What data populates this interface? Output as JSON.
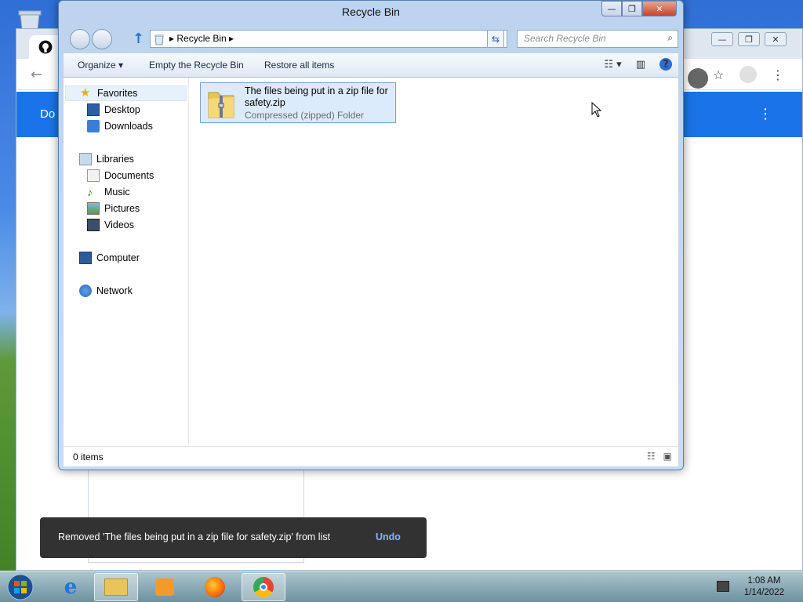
{
  "explorer": {
    "title": "Recycle Bin",
    "breadcrumb": "Recycle Bin",
    "search_placeholder": "Search Recycle Bin",
    "commands": {
      "organize": "Organize ▾",
      "empty": "Empty the Recycle Bin",
      "restore": "Restore all items"
    },
    "nav": {
      "favorites": "Favorites",
      "desktop": "Desktop",
      "downloads": "Downloads",
      "libraries": "Libraries",
      "documents": "Documents",
      "music": "Music",
      "pictures": "Pictures",
      "videos": "Videos",
      "computer": "Computer",
      "network": "Network"
    },
    "file": {
      "name": "The files being put in a zip file for safety.zip",
      "type": "Compressed (zipped) Folder"
    },
    "status": "0 items"
  },
  "chrome": {
    "band_text": "Do"
  },
  "snackbar": {
    "message": "Removed 'The files being put in a zip file for safety.zip' from list",
    "undo": "Undo"
  },
  "taskbar": {
    "time": "1:08 AM",
    "date": "1/14/2022"
  },
  "colors": {
    "chrome_blue": "#1a73e8",
    "snackbar_bg": "#323232",
    "undo_link": "#8ab4f8"
  }
}
